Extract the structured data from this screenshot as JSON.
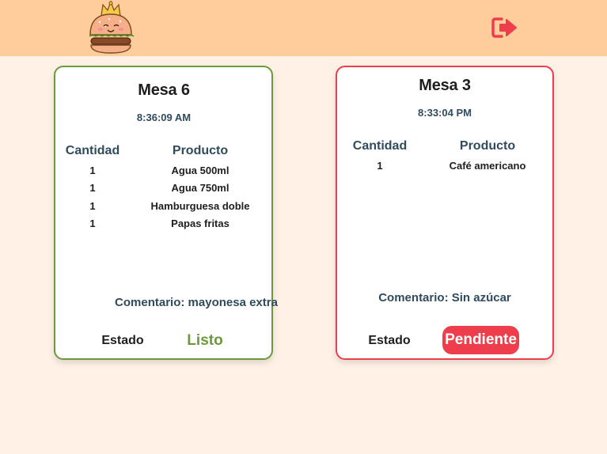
{
  "header": {
    "logo_icon": "burger-mascot-logo",
    "logout_icon": "logout-icon",
    "bg_color": "#ffcc9c",
    "accent_color": "#ee3d4b"
  },
  "orders": [
    {
      "title": "Mesa 6",
      "time": "8:36:09 AM",
      "qty_header": "Cantidad",
      "product_header": "Producto",
      "items": [
        {
          "qty": "1",
          "product": "Agua 500ml"
        },
        {
          "qty": "1",
          "product": "Agua 750ml"
        },
        {
          "qty": "1",
          "product": "Hamburguesa doble"
        },
        {
          "qty": "1",
          "product": "Papas fritas"
        }
      ],
      "comment": "Comentario: mayonesa extra",
      "status_label": "Estado",
      "status": "Listo",
      "status_color": "#6a9a3a"
    },
    {
      "title": "Mesa 3",
      "time": "8:33:04 PM",
      "qty_header": "Cantidad",
      "product_header": "Producto",
      "items": [
        {
          "qty": "1",
          "product": "Café americano"
        }
      ],
      "comment": "Comentario: Sin azúcar",
      "status_label": "Estado",
      "status": "Pendiente",
      "status_color": "#ee3d4b"
    }
  ]
}
